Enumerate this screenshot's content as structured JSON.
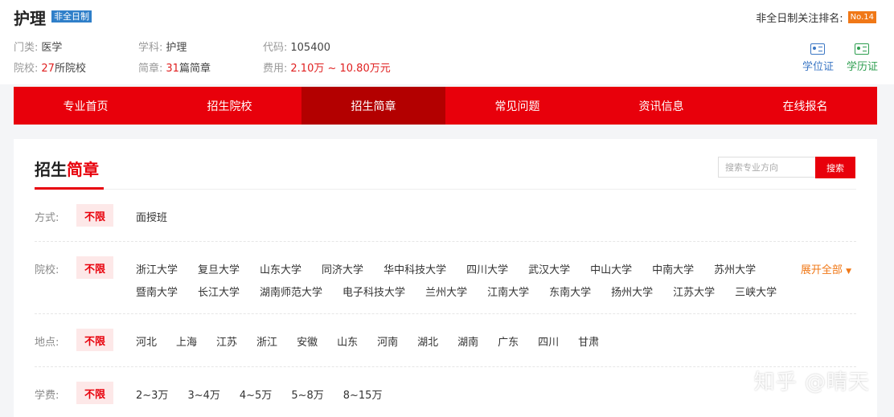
{
  "header": {
    "title": "护理",
    "badge": "非全日制",
    "rank_label": "非全日制关注排名:",
    "rank_value": "No.14",
    "meta": {
      "category_label": "门类:",
      "category_value": "医学",
      "subject_label": "学科:",
      "subject_value": "护理",
      "code_label": "代码:",
      "code_value": "105400",
      "schools_label": "院校:",
      "schools_count": "27",
      "schools_suffix": "所院校",
      "brochure_label": "简章:",
      "brochure_count": "31",
      "brochure_suffix": "篇简章",
      "fee_label": "费用:",
      "fee_value": "2.10万 ~ 10.80万元"
    },
    "certs": [
      {
        "label": "学位证",
        "icon": "id-card-icon",
        "color": "#3a76c4"
      },
      {
        "label": "学历证",
        "icon": "id-card-icon",
        "color": "#2d9e4f"
      }
    ]
  },
  "nav": {
    "items": [
      "专业首页",
      "招生院校",
      "招生简章",
      "常见问题",
      "资讯信息",
      "在线报名"
    ],
    "active_index": 2
  },
  "section": {
    "title_part1": "招生",
    "title_part2": "简章",
    "search_placeholder": "搜索专业方向",
    "search_button": "搜索"
  },
  "filters": {
    "unlimited": "不限",
    "mode": {
      "label": "方式:",
      "options": [
        "面授班"
      ]
    },
    "school": {
      "label": "院校:",
      "expand": "展开全部",
      "options_row1": [
        "浙江大学",
        "复旦大学",
        "山东大学",
        "同济大学",
        "华中科技大学",
        "四川大学",
        "武汉大学",
        "中山大学",
        "中南大学",
        "苏州大学"
      ],
      "options_row2": [
        "暨南大学",
        "长江大学",
        "湖南师范大学",
        "电子科技大学",
        "兰州大学",
        "江南大学",
        "东南大学",
        "扬州大学",
        "江苏大学",
        "三峡大学"
      ]
    },
    "location": {
      "label": "地点:",
      "options": [
        "河北",
        "上海",
        "江苏",
        "浙江",
        "安徽",
        "山东",
        "河南",
        "湖北",
        "湖南",
        "广东",
        "四川",
        "甘肃"
      ]
    },
    "fee": {
      "label": "学费:",
      "options": [
        "2~3万",
        "3~4万",
        "4~5万",
        "5~8万",
        "8~15万"
      ]
    }
  },
  "watermark": "知乎 @晴天",
  "colors": {
    "brand_red": "#e8000b",
    "nav_active": "#b30000",
    "badge_blue": "#2f7fc9",
    "rank_orange": "#f07817"
  }
}
